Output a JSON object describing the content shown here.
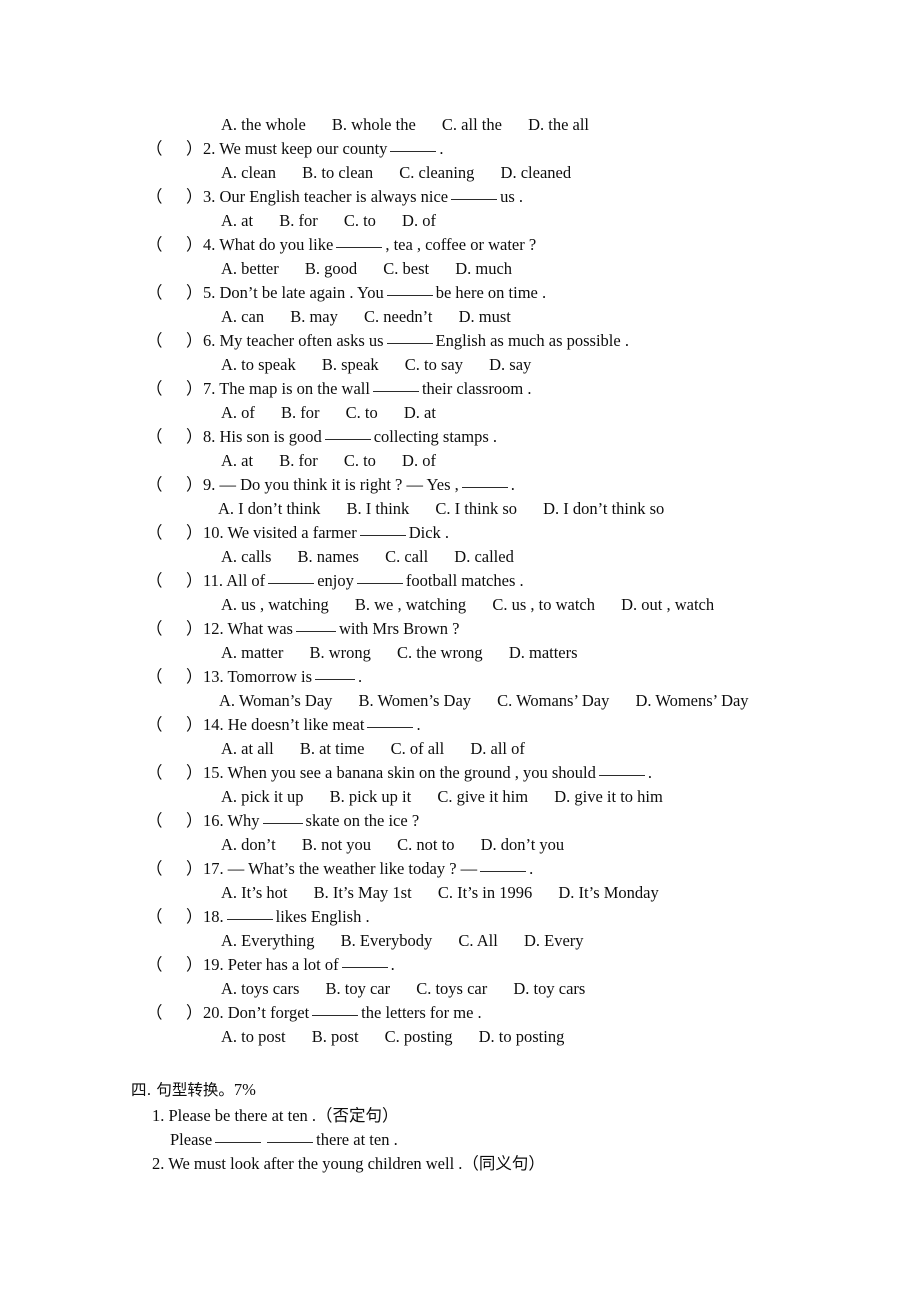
{
  "document": {
    "type": "english-exam-worksheet",
    "text_color": "#0d0d0d",
    "background_color": "#ffffff"
  },
  "multiple_choice": {
    "paren_open": "（",
    "paren_close": "）",
    "questions": [
      {
        "number": "",
        "stem_parts": [],
        "stem": "",
        "options": [
          "A. the whole",
          "B. whole the",
          "C. all the",
          "D. the all"
        ],
        "stem_visible": false
      },
      {
        "number": "2.",
        "stem_before": "2. We must keep our county",
        "stem_after": ".",
        "options": [
          "A. clean",
          "B. to clean",
          "C. cleaning",
          "D. cleaned"
        ],
        "stem_visible": true
      },
      {
        "number": "3.",
        "stem_before": "3. Our English teacher is always nice",
        "stem_after": "us .",
        "options": [
          "A. at",
          "B. for",
          "C. to",
          "D. of"
        ],
        "stem_visible": true
      },
      {
        "number": "4.",
        "stem_before": "4. What do you like",
        "stem_after": ", tea , coffee or water ?",
        "options": [
          "A. better",
          "B. good",
          "C. best",
          "D. much"
        ],
        "stem_visible": true
      },
      {
        "number": "5.",
        "stem_before": "5. Don’t be late again . You",
        "stem_after": "be here on time .",
        "options": [
          "A. can",
          "B. may",
          "C. needn’t",
          "D. must"
        ],
        "stem_visible": true
      },
      {
        "number": "6.",
        "stem_before": "6. My teacher often asks us",
        "stem_after": "English as much as possible .",
        "options": [
          "A. to speak",
          "B. speak",
          "C. to say",
          "D. say"
        ],
        "stem_visible": true
      },
      {
        "number": "7.",
        "stem_before": "7. The map is on the wall",
        "stem_after": "their classroom .",
        "options": [
          "A. of",
          "B. for",
          "C. to",
          "D. at"
        ],
        "stem_visible": true
      },
      {
        "number": "8.",
        "stem_before": "8. His son is good",
        "stem_after": "collecting stamps .",
        "options": [
          "A. at",
          "B. for",
          "C. to",
          "D. of"
        ],
        "stem_visible": true
      },
      {
        "number": "9.",
        "stem_before": "9. — Do you think it is right ? — Yes ,",
        "stem_after": ".",
        "options": [
          "A. I don’t think",
          "B. I think",
          "C. I think so",
          "D. I don’t think so"
        ],
        "stem_visible": true
      },
      {
        "number": "10.",
        "stem_before": "10. We visited a farmer",
        "stem_after": "Dick .",
        "options": [
          "A. calls",
          "B. names",
          "C. call",
          "D. called"
        ],
        "stem_visible": true
      },
      {
        "number": "11.",
        "stem_before": "11. All of",
        "stem_middle": "enjoy",
        "stem_after": "football matches .",
        "two_blanks": true,
        "options": [
          "A. us , watching",
          "B. we , watching",
          "C. us , to watch",
          "D. out , watch"
        ],
        "stem_visible": true
      },
      {
        "number": "12.",
        "stem_before": "12. What was",
        "stem_after": "with Mrs Brown ?",
        "options": [
          "A. matter",
          "B. wrong",
          "C. the wrong",
          "D. matters"
        ],
        "stem_visible": true
      },
      {
        "number": "13.",
        "stem_before": "13. Tomorrow is",
        "stem_after": ".",
        "options": [
          "A. Woman’s Day",
          "B. Women’s Day",
          "C. Womans’ Day",
          "D. Womens’ Day"
        ],
        "stem_visible": true
      },
      {
        "number": "14.",
        "stem_before": "14. He doesn’t like meat",
        "stem_after": ".",
        "options": [
          "A. at all",
          "B. at time",
          "C. of all",
          "D. all of"
        ],
        "stem_visible": true
      },
      {
        "number": "15.",
        "stem_before": "15. When you see a banana skin on the ground , you should",
        "stem_after": ".",
        "options": [
          "A. pick it up",
          "B. pick up it",
          "C. give it him",
          "D. give it to him"
        ],
        "stem_visible": true
      },
      {
        "number": "16.",
        "stem_before": "16. Why",
        "stem_after": "skate on the ice ?",
        "options": [
          "A. don’t",
          "B. not you",
          "C. not to",
          "D. don’t you"
        ],
        "stem_visible": true
      },
      {
        "number": "17.",
        "stem_before": "17. — What’s the weather like today ? —",
        "stem_after": ".",
        "options": [
          "A. It’s hot",
          "B. It’s May 1st",
          "C. It’s in 1996",
          "D. It’s Monday"
        ],
        "stem_visible": true
      },
      {
        "number": "18.",
        "stem_before": "18.",
        "stem_after": "likes English .",
        "options": [
          "A. Everything",
          "B. Everybody",
          "C. All",
          "D. Every"
        ],
        "stem_visible": true
      },
      {
        "number": "19.",
        "stem_before": "19. Peter has a lot of",
        "stem_after": ".",
        "options": [
          "A. toys cars",
          "B. toy car",
          "C. toys car",
          "D. toy cars"
        ],
        "stem_visible": true
      },
      {
        "number": "20.",
        "stem_before": "20. Don’t forget",
        "stem_after": "the letters for me .",
        "options": [
          "A. to post",
          "B. post",
          "C. posting",
          "D. to posting"
        ],
        "stem_visible": true
      }
    ]
  },
  "section_four": {
    "heading_cjk": "四. 句型转换。",
    "heading_score": "7%",
    "item1_prompt": "1. Please be there at ten .（否定句）",
    "item1_answer_before": "Please",
    "item1_answer_after": "there at ten .",
    "item2_prompt": "2. We must look after the young children well .（同义句）"
  }
}
